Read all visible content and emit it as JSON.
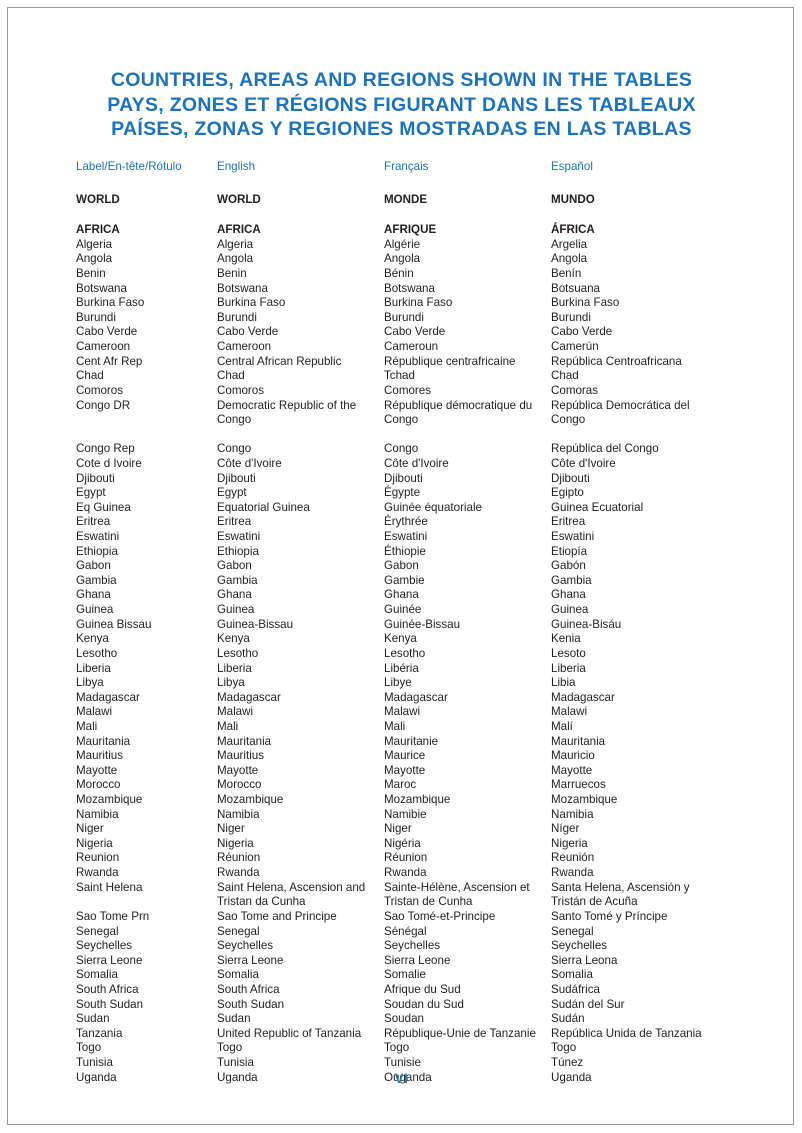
{
  "title": {
    "line_en": "COUNTRIES, AREAS AND REGIONS SHOWN IN THE TABLES",
    "line_fr": "PAYS, ZONES ET RÉGIONS FIGURANT DANS LES TABLEAUX",
    "line_es": "PAÍSES, ZONAS Y REGIONES MOSTRADAS EN LAS TABLAS"
  },
  "colors": {
    "title_blue": "#1d72b8",
    "header_blue": "#1d72b8",
    "body_text": "#231f20",
    "page_number": "#2b7a9e",
    "page_border": "#9a9a9a"
  },
  "columns": {
    "label": "Label/En-tête/Rótulo",
    "english": "English",
    "french": "Français",
    "spanish": "Español"
  },
  "rows": [
    {
      "label": "WORLD",
      "english": "WORLD",
      "french": "MONDE",
      "spanish": "MUNDO",
      "bold": true,
      "lines": 1
    },
    {
      "label": "AFRICA",
      "english": "AFRICA",
      "french": "AFRIQUE",
      "spanish": "ÁFRICA",
      "bold": true,
      "lines": 1
    },
    {
      "label": "Algeria",
      "english": "Algeria",
      "french": "Algérie",
      "spanish": "Argelia",
      "bold": false,
      "lines": 1
    },
    {
      "label": "Angola",
      "english": "Angola",
      "french": "Angola",
      "spanish": "Angola",
      "bold": false,
      "lines": 1
    },
    {
      "label": "Benin",
      "english": "Benin",
      "french": "Bénin",
      "spanish": "Benín",
      "bold": false,
      "lines": 1
    },
    {
      "label": "Botswana",
      "english": "Botswana",
      "french": "Botswana",
      "spanish": "Botsuana",
      "bold": false,
      "lines": 1
    },
    {
      "label": "Burkina Faso",
      "english": "Burkina Faso",
      "french": "Burkina Faso",
      "spanish": "Burkina Faso",
      "bold": false,
      "lines": 1
    },
    {
      "label": "Burundi",
      "english": "Burundi",
      "french": "Burundi",
      "spanish": "Burundi",
      "bold": false,
      "lines": 1
    },
    {
      "label": "Cabo Verde",
      "english": "Cabo Verde",
      "french": "Cabo Verde",
      "spanish": "Cabo Verde",
      "bold": false,
      "lines": 1
    },
    {
      "label": "Cameroon",
      "english": "Cameroon",
      "french": "Cameroun",
      "spanish": "Camerún",
      "bold": false,
      "lines": 1
    },
    {
      "label": "Cent Afr Rep",
      "english": "Central African Republic",
      "french": "République centrafricaine",
      "spanish": "República Centroafricana",
      "bold": false,
      "lines": 1
    },
    {
      "label": "Chad",
      "english": "Chad",
      "french": "Tchad",
      "spanish": "Chad",
      "bold": false,
      "lines": 1
    },
    {
      "label": "Comoros",
      "english": "Comoros",
      "french": "Comores",
      "spanish": "Comoras",
      "bold": false,
      "lines": 1
    },
    {
      "label": "Congo DR",
      "english": "Democratic Republic of the\nCongo",
      "french": "République démocratique du\nCongo",
      "spanish": "República Democrática del\nCongo",
      "bold": false,
      "lines": 2
    },
    {
      "label": "Congo Rep",
      "english": "Congo",
      "french": "Congo",
      "spanish": "República del Congo",
      "bold": false,
      "lines": 1
    },
    {
      "label": "Cote d Ivoire",
      "english": "Côte d'Ivoire",
      "french": "Côte d'Ivoire",
      "spanish": "Côte d'Ivoire",
      "bold": false,
      "lines": 1
    },
    {
      "label": "Djibouti",
      "english": "Djibouti",
      "french": "Djibouti",
      "spanish": "Djibouti",
      "bold": false,
      "lines": 1
    },
    {
      "label": "Egypt",
      "english": "Egypt",
      "french": "Égypte",
      "spanish": "Egipto",
      "bold": false,
      "lines": 1
    },
    {
      "label": "Eq Guinea",
      "english": "Equatorial Guinea",
      "french": "Guinée équatoriale",
      "spanish": "Guinea Ecuatorial",
      "bold": false,
      "lines": 1
    },
    {
      "label": "Eritrea",
      "english": "Eritrea",
      "french": "Érythrée",
      "spanish": "Eritrea",
      "bold": false,
      "lines": 1
    },
    {
      "label": "Eswatini",
      "english": "Eswatini",
      "french": "Eswatini",
      "spanish": "Eswatini",
      "bold": false,
      "lines": 1
    },
    {
      "label": "Ethiopia",
      "english": "Ethiopia",
      "french": "Éthiopie",
      "spanish": "Etiopía",
      "bold": false,
      "lines": 1
    },
    {
      "label": "Gabon",
      "english": "Gabon",
      "french": "Gabon",
      "spanish": "Gabón",
      "bold": false,
      "lines": 1
    },
    {
      "label": "Gambia",
      "english": "Gambia",
      "french": "Gambie",
      "spanish": "Gambia",
      "bold": false,
      "lines": 1
    },
    {
      "label": "Ghana",
      "english": "Ghana",
      "french": "Ghana",
      "spanish": "Ghana",
      "bold": false,
      "lines": 1
    },
    {
      "label": "Guinea",
      "english": "Guinea",
      "french": "Guinée",
      "spanish": "Guinea",
      "bold": false,
      "lines": 1
    },
    {
      "label": "Guinea Bissau",
      "english": "Guinea-Bissau",
      "french": "Guinée-Bissau",
      "spanish": "Guinea-Bisáu",
      "bold": false,
      "lines": 1
    },
    {
      "label": "Kenya",
      "english": "Kenya",
      "french": "Kenya",
      "spanish": "Kenia",
      "bold": false,
      "lines": 1
    },
    {
      "label": "Lesotho",
      "english": "Lesotho",
      "french": "Lesotho",
      "spanish": "Lesoto",
      "bold": false,
      "lines": 1
    },
    {
      "label": "Liberia",
      "english": "Liberia",
      "french": "Libéria",
      "spanish": "Liberia",
      "bold": false,
      "lines": 1
    },
    {
      "label": "Libya",
      "english": "Libya",
      "french": "Libye",
      "spanish": "Libia",
      "bold": false,
      "lines": 1
    },
    {
      "label": "Madagascar",
      "english": "Madagascar",
      "french": "Madagascar",
      "spanish": "Madagascar",
      "bold": false,
      "lines": 1
    },
    {
      "label": "Malawi",
      "english": "Malawi",
      "french": "Malawi",
      "spanish": "Malawi",
      "bold": false,
      "lines": 1
    },
    {
      "label": "Mali",
      "english": "Mali",
      "french": "Mali",
      "spanish": "Malí",
      "bold": false,
      "lines": 1
    },
    {
      "label": "Mauritania",
      "english": "Mauritania",
      "french": "Mauritanie",
      "spanish": "Mauritania",
      "bold": false,
      "lines": 1
    },
    {
      "label": "Mauritius",
      "english": "Mauritius",
      "french": "Maurice",
      "spanish": "Mauricio",
      "bold": false,
      "lines": 1
    },
    {
      "label": "Mayotte",
      "english": "Mayotte",
      "french": "Mayotte",
      "spanish": "Mayotte",
      "bold": false,
      "lines": 1
    },
    {
      "label": "Morocco",
      "english": "Morocco",
      "french": "Maroc",
      "spanish": "Marruecos",
      "bold": false,
      "lines": 1
    },
    {
      "label": "Mozambique",
      "english": "Mozambique",
      "french": "Mozambique",
      "spanish": "Mozambique",
      "bold": false,
      "lines": 1
    },
    {
      "label": "Namibia",
      "english": "Namibia",
      "french": "Namibie",
      "spanish": "Namibia",
      "bold": false,
      "lines": 1
    },
    {
      "label": "Niger",
      "english": "Niger",
      "french": "Niger",
      "spanish": "Níger",
      "bold": false,
      "lines": 1
    },
    {
      "label": "Nigeria",
      "english": "Nigeria",
      "french": "Nigéria",
      "spanish": "Nigeria",
      "bold": false,
      "lines": 1
    },
    {
      "label": "Reunion",
      "english": "Réunion",
      "french": "Réunion",
      "spanish": "Reunión",
      "bold": false,
      "lines": 1
    },
    {
      "label": "Rwanda",
      "english": "Rwanda",
      "french": "Rwanda",
      "spanish": "Rwanda",
      "bold": false,
      "lines": 1
    },
    {
      "label": "Saint Helena",
      "english": "Saint Helena, Ascension and\nTristan da Cunha",
      "french": "Sainte-Hélène, Ascension et\nTristan de Cunha",
      "spanish": "Santa Helena, Ascensión y\nTristán de Acuña",
      "bold": false,
      "lines": 2
    },
    {
      "label": "Sao Tome Prn",
      "english": "Sao Tome and Principe",
      "french": "Sao Tomé-et-Principe",
      "spanish": "Santo Tomé y Príncipe",
      "bold": false,
      "lines": 1
    },
    {
      "label": "Senegal",
      "english": "Senegal",
      "french": "Sénégal",
      "spanish": "Senegal",
      "bold": false,
      "lines": 1
    },
    {
      "label": "Seychelles",
      "english": "Seychelles",
      "french": "Seychelles",
      "spanish": "Seychelles",
      "bold": false,
      "lines": 1
    },
    {
      "label": "Sierra Leone",
      "english": "Sierra Leone",
      "french": "Sierra Leone",
      "spanish": "Sierra Leona",
      "bold": false,
      "lines": 1
    },
    {
      "label": "Somalia",
      "english": "Somalia",
      "french": "Somalie",
      "spanish": "Somalia",
      "bold": false,
      "lines": 1
    },
    {
      "label": "South Africa",
      "english": "South Africa",
      "french": "Afrique du Sud",
      "spanish": "Sudáfrica",
      "bold": false,
      "lines": 1
    },
    {
      "label": "South Sudan",
      "english": "South Sudan",
      "french": "Soudan du Sud",
      "spanish": "Sudán del Sur",
      "bold": false,
      "lines": 1
    },
    {
      "label": "Sudan",
      "english": "Sudan",
      "french": "Soudan",
      "spanish": "Sudán",
      "bold": false,
      "lines": 1
    },
    {
      "label": "Tanzania",
      "english": "United Republic of Tanzania",
      "french": "République-Unie de Tanzanie",
      "spanish": "República Unida de Tanzania",
      "bold": false,
      "lines": 1
    },
    {
      "label": "Togo",
      "english": "Togo",
      "french": "Togo",
      "spanish": "Togo",
      "bold": false,
      "lines": 1
    },
    {
      "label": "Tunisia",
      "english": "Tunisia",
      "french": "Tunisie",
      "spanish": "Túnez",
      "bold": false,
      "lines": 1
    },
    {
      "label": "Uganda",
      "english": "Uganda",
      "french": "Ouganda",
      "spanish": "Uganda",
      "bold": false,
      "lines": 1
    }
  ],
  "page_number": "VI"
}
